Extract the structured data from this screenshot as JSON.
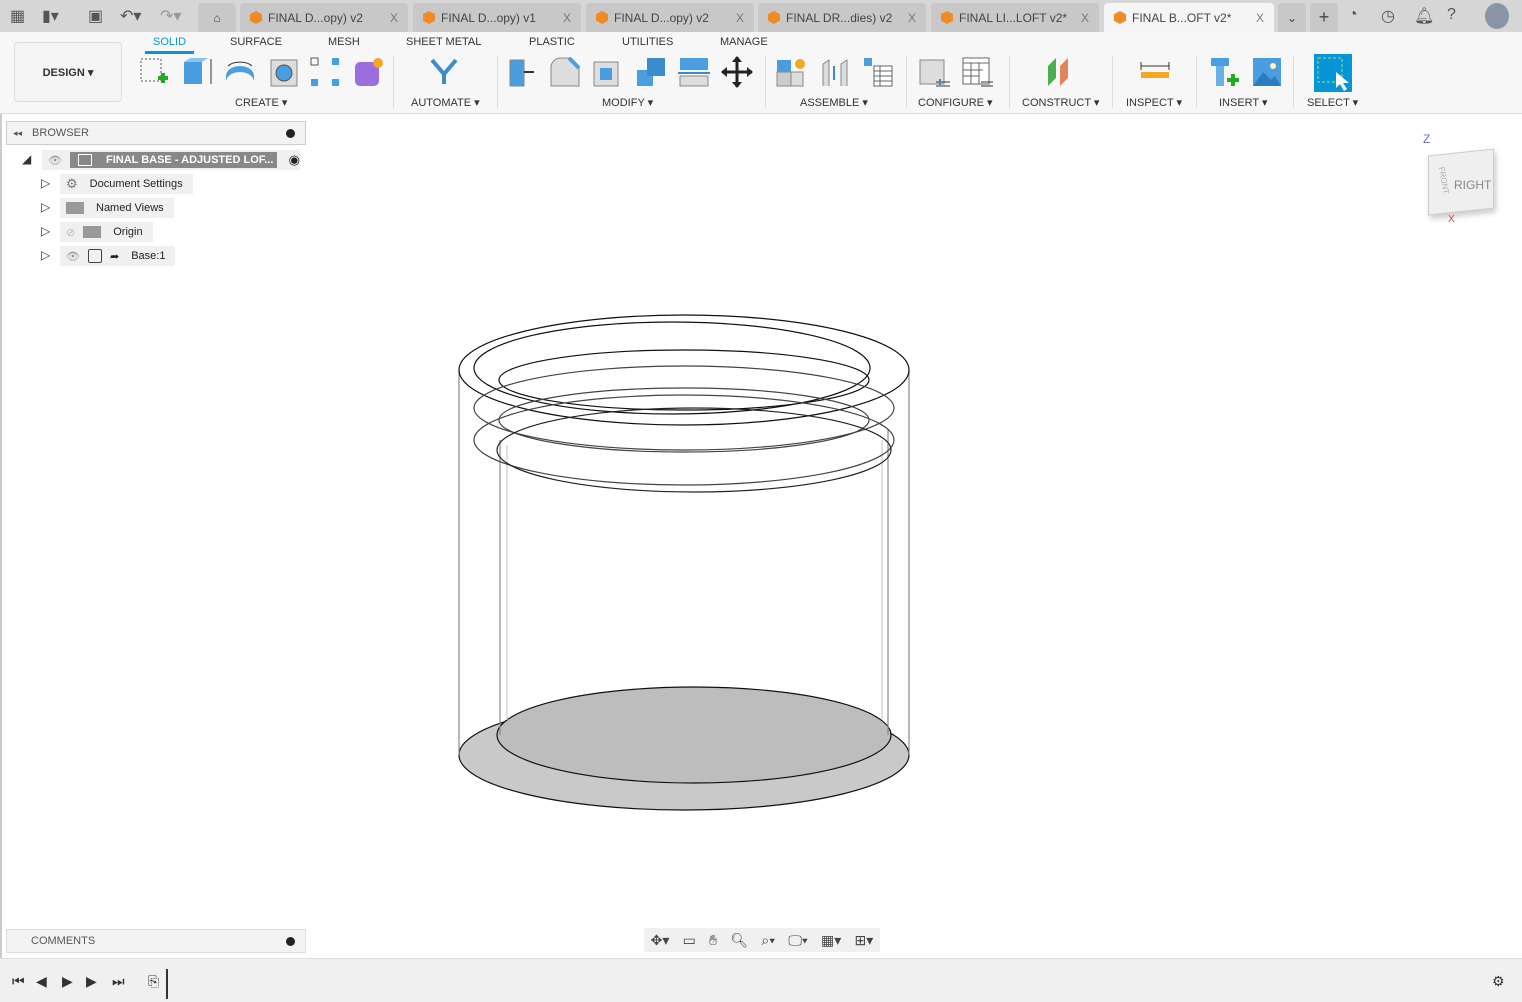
{
  "quick_access": {
    "icons": [
      "grid-menu-icon",
      "file-icon",
      "save-icon",
      "undo-icon",
      "redo-icon"
    ]
  },
  "tabs": [
    {
      "label": "FINAL D...opy) v2",
      "active": false
    },
    {
      "label": "FINAL D...opy) v1",
      "active": false
    },
    {
      "label": "FINAL D...opy) v2",
      "active": false
    },
    {
      "label": "FINAL DR...dies) v2",
      "active": false
    },
    {
      "label": "FINAL LI...LOFT v2*",
      "active": false
    },
    {
      "label": "FINAL B...OFT v2*",
      "active": true
    }
  ],
  "tab_close": "X",
  "workspace": "DESIGN ▾",
  "toolbar_tabs": [
    "SOLID",
    "SURFACE",
    "MESH",
    "SHEET METAL",
    "PLASTIC",
    "UTILITIES",
    "MANAGE"
  ],
  "groups": [
    "CREATE ▾",
    "AUTOMATE ▾",
    "MODIFY ▾",
    "ASSEMBLE ▾",
    "CONFIGURE ▾",
    "CONSTRUCT ▾",
    "INSPECT ▾",
    "INSERT ▾",
    "SELECT ▾"
  ],
  "browser": {
    "title": "BROWSER",
    "root": "FINAL BASE - ADJUSTED LOF...",
    "items": [
      "Document Settings",
      "Named Views",
      "Origin",
      "Base:1"
    ]
  },
  "comments": {
    "title": "COMMENTS"
  },
  "viewcube": {
    "face": "RIGHT",
    "side": "FRONT",
    "axis_z": "Z",
    "axis_x": "X"
  },
  "colors": {
    "accent": "#0696d7",
    "tab_icon": "#f08a24"
  }
}
